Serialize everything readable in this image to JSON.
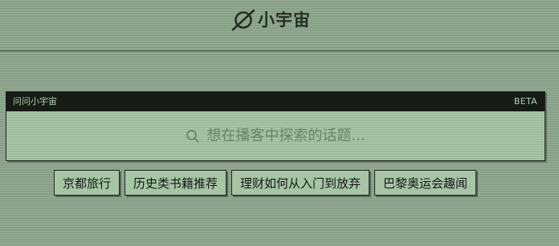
{
  "brand": {
    "name": "小宇宙",
    "icon": "planet-icon"
  },
  "search_panel": {
    "title": "问问小宇宙",
    "badge": "BETA",
    "placeholder": "想在播客中探索的话题...",
    "icon": "search-icon"
  },
  "suggestions": [
    {
      "label": "京都旅行"
    },
    {
      "label": "历史类书籍推荐"
    },
    {
      "label": "理财如何从入门到放弃"
    },
    {
      "label": "巴黎奥运会趣闻"
    }
  ],
  "colors": {
    "background": "#8ea58e",
    "panel_bar": "#161b16",
    "panel_body": "#a4c1a4",
    "chip": "#a7c4a7",
    "text_dark": "#243024"
  }
}
